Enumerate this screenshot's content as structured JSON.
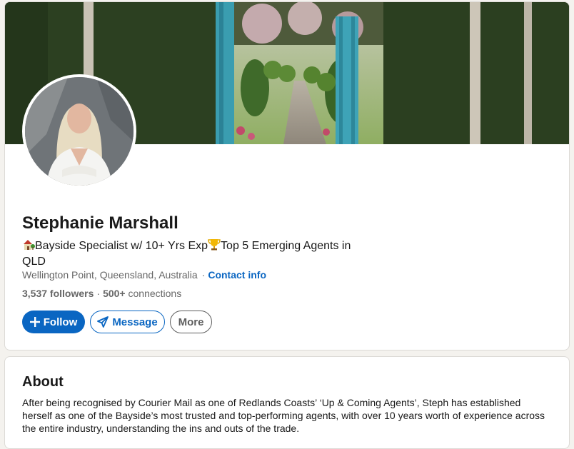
{
  "profile": {
    "name": "Stephanie Marshall",
    "headline_icon_1": "house-with-garden-emoji",
    "headline_part_1": "Bayside Specialist w/ 10+ Yrs Exp",
    "headline_icon_2": "trophy-emoji",
    "headline_part_2": "Top 5 Emerging Agents in QLD",
    "location": "Wellington Point, Queensland, Australia",
    "separator": "·",
    "contact_info_label": "Contact info",
    "followers": "3,537 followers",
    "connections_count": "500+",
    "connections_label": "connections"
  },
  "actions": {
    "follow_label": "Follow",
    "follow_icon": "plus-icon",
    "message_label": "Message",
    "message_icon": "paper-plane-icon",
    "more_label": "More"
  },
  "about": {
    "title": "About",
    "text": "After being recognised by Courier Mail as one of Redlands Coasts’ ‘Up & Coming Agents’, Steph has established herself as one of the Bayside’s most trusted and top-performing agents, with over 10 years worth of experience across the entire industry, understanding the ins and outs of the trade."
  },
  "colors": {
    "brand_blue": "#0a66c2",
    "page_background": "#f4f2ee",
    "muted_text": "#666666"
  }
}
